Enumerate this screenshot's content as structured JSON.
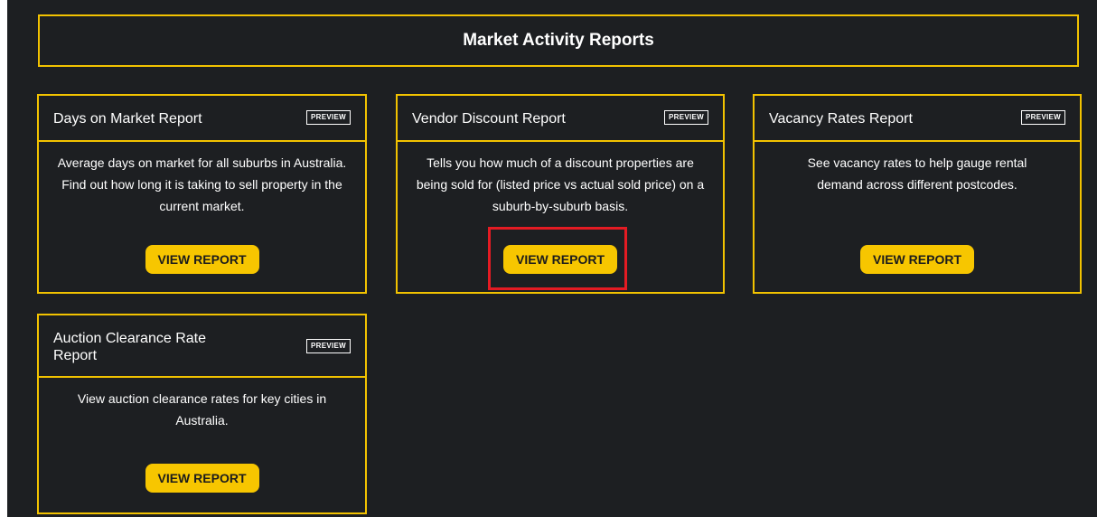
{
  "header": {
    "title": "Market Activity Reports"
  },
  "cards": [
    {
      "title": "Days on Market Report",
      "badge": "PREVIEW",
      "description": "Average days on market for all suburbs in Australia. Find out how long it is taking to sell property in the current market.",
      "button": "VIEW REPORT"
    },
    {
      "title": "Vendor Discount Report",
      "badge": "PREVIEW",
      "description": "Tells you how much of a discount properties are being sold for (listed price vs actual sold price) on a suburb-by-suburb basis.",
      "button": "VIEW REPORT"
    },
    {
      "title": "Vacancy Rates Report",
      "badge": "PREVIEW",
      "description": "See vacancy rates to help gauge rental demand across different postcodes.",
      "button": "VIEW REPORT"
    },
    {
      "title": "Auction Clearance Rate Report",
      "badge": "PREVIEW",
      "description": "View auction clearance rates for key cities in Australia.",
      "button": "VIEW REPORT"
    }
  ],
  "colors": {
    "background": "#1d1f22",
    "accent": "#f2c200",
    "button": "#f7c600",
    "highlight": "#e41b23"
  }
}
